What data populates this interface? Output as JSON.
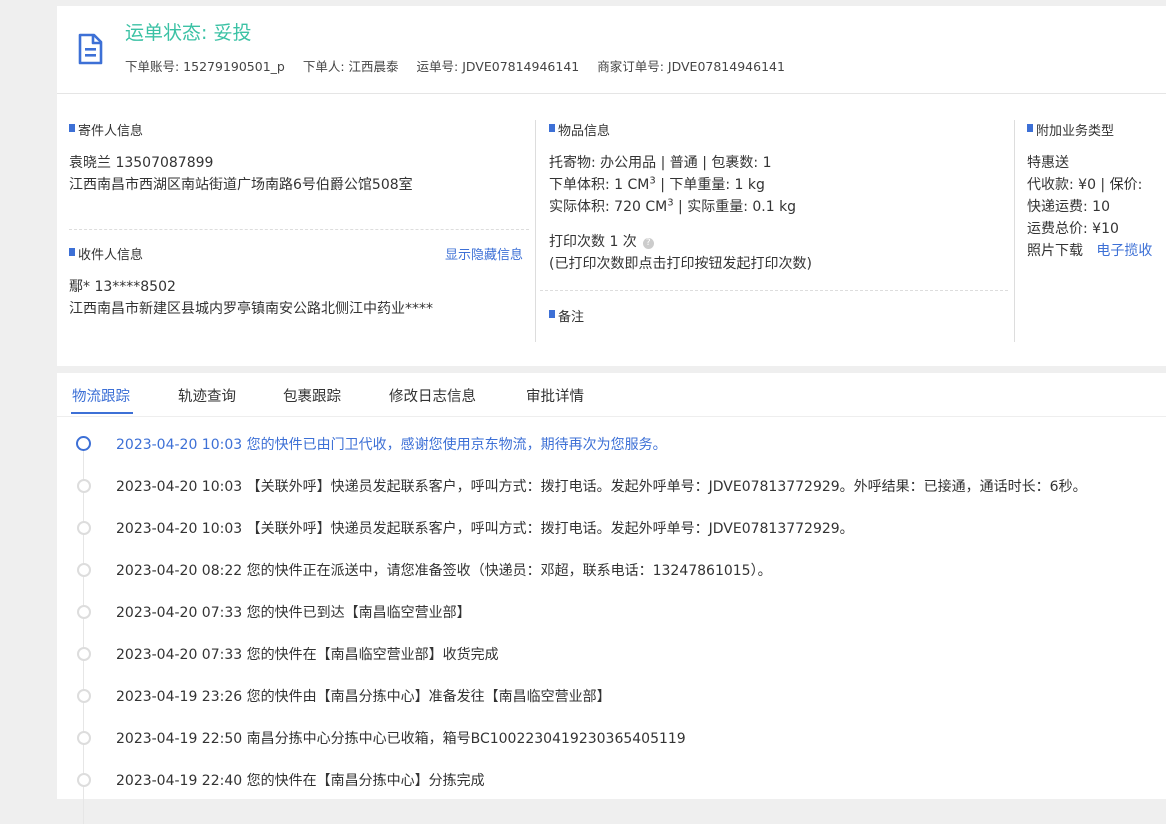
{
  "header": {
    "status": "运单状态: 妥投",
    "account": "下单账号: 15279190501_p",
    "orderer": "下单人: 江西晨泰",
    "waybill": "运单号: JDVE07814946141",
    "merchant_order": "商家订单号: JDVE07814946141"
  },
  "sender": {
    "title": "寄件人信息",
    "name_phone": "袁晓兰   13507087899",
    "address": "江西南昌市西湖区南站街道广场南路6号伯爵公馆508室"
  },
  "receiver": {
    "title": "收件人信息",
    "show_hidden": "显示隐藏信息",
    "name_phone": "鄢*   13****8502",
    "address": "江西南昌市新建区县城内罗亭镇南安公路北侧江中药业****"
  },
  "goods": {
    "title": "物品信息",
    "line1": "托寄物:  办公用品 | 普通  | 包裹数:  1",
    "order_volume_label": "下单体积:   1 CM",
    "cube": "3",
    "order_weight": " | 下单重量:  1 kg",
    "actual_volume_label": "实际体积:   720 CM",
    "actual_weight": " | 实际重量:  0.1 kg",
    "print_count": "打印次数   1 次",
    "print_note": "(已打印次数即点击打印按钮发起打印次数)",
    "remark_title": "备注"
  },
  "extra": {
    "title": "附加业务类型",
    "service": "特惠送",
    "cod": "代收款: ¥0  |  保价:",
    "freight": "快递运费:  10",
    "total": "运费总价:  ¥10",
    "photo_label": "照片下载",
    "photo_link": "电子揽收"
  },
  "tabs": [
    "物流跟踪",
    "轨迹查询",
    "包裹跟踪",
    "修改日志信息",
    "审批详情"
  ],
  "timeline": [
    "2023-04-20 10:03  您的快件已由门卫代收，感谢您使用京东物流，期待再次为您服务。",
    "2023-04-20 10:03  【关联外呼】快递员发起联系客户，呼叫方式：拨打电话。发起外呼单号：JDVE07813772929。外呼结果：已接通，通话时长：6秒。",
    "2023-04-20 10:03  【关联外呼】快递员发起联系客户，呼叫方式：拨打电话。发起外呼单号：JDVE07813772929。",
    "2023-04-20 08:22  您的快件正在派送中，请您准备签收（快递员：邓超，联系电话：13247861015）。",
    "2023-04-20 07:33  您的快件已到达【南昌临空营业部】",
    "2023-04-20 07:33  您的快件在【南昌临空营业部】收货完成",
    "2023-04-19 23:26  您的快件由【南昌分拣中心】准备发往【南昌临空营业部】",
    "2023-04-19 22:50  南昌分拣中心分拣中心已收箱，箱号BC1002230419230365405119",
    "2023-04-19 22:40  您的快件在【南昌分拣中心】分拣完成"
  ],
  "colors": {
    "accent": "#3d70d6",
    "status": "#3cc2a5"
  }
}
